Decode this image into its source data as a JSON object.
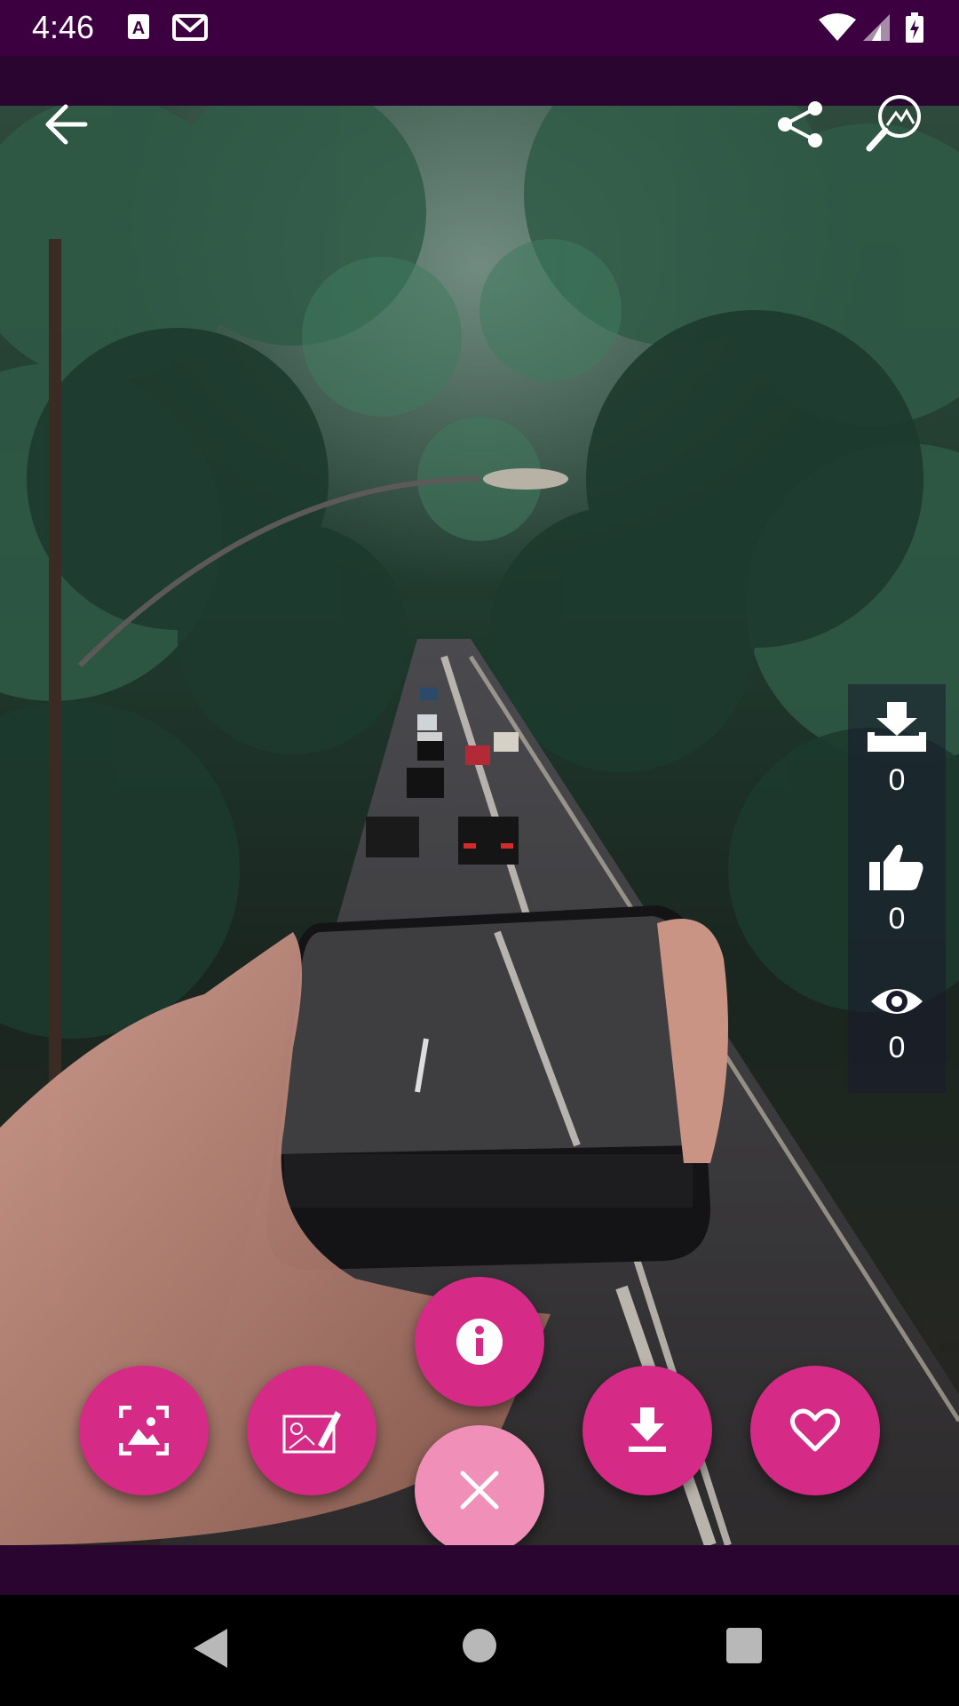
{
  "status_bar": {
    "time": "4:46",
    "icons": [
      "a-font-icon",
      "gmail-icon",
      "wifi-icon",
      "signal-icon",
      "battery-icon"
    ]
  },
  "toolbar": {
    "back_icon": "arrow-left-icon",
    "share_icon": "share-icon",
    "search_image_icon": "image-search-icon"
  },
  "stats": {
    "downloads": "0",
    "likes": "0",
    "views": "0"
  },
  "fabs": [
    "set-wallpaper",
    "edit-image",
    "info",
    "close",
    "download",
    "favorite"
  ],
  "colors": {
    "status_bar": "#3c0041",
    "app_bar": "#2a0530",
    "fab": "#d52a86",
    "fab_close": "#f08fb8"
  },
  "nav": [
    "back",
    "home",
    "recents"
  ]
}
